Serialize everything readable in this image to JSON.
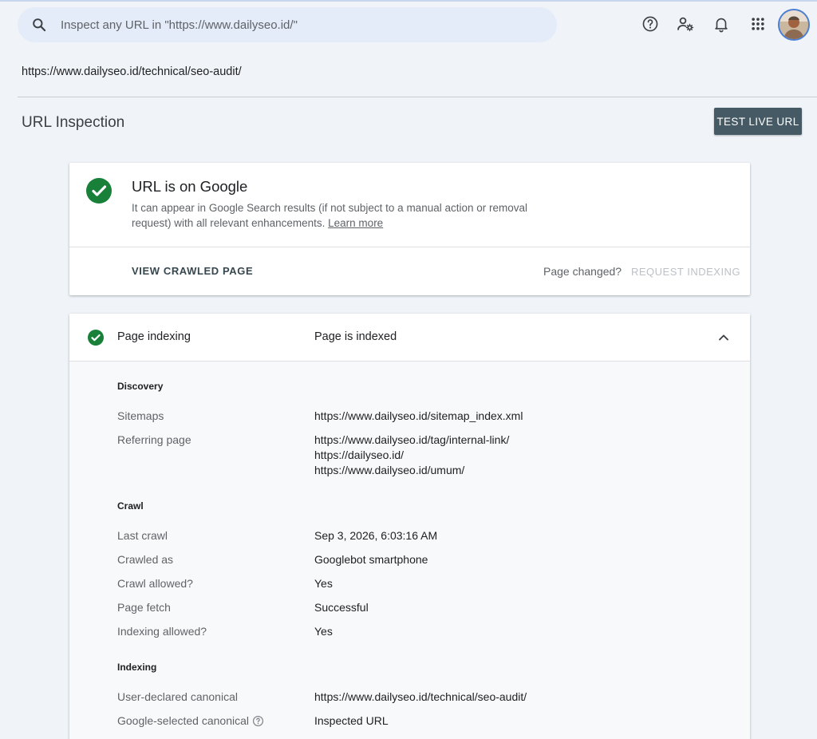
{
  "search": {
    "placeholder": "Inspect any URL in \"https://www.dailyseo.id/\""
  },
  "toolbar_icons": [
    "help-icon",
    "manage-users-icon",
    "notifications-icon",
    "apps-grid-icon"
  ],
  "page_url": "https://www.dailyseo.id/technical/seo-audit/",
  "page_title": "URL Inspection",
  "test_live_url": "TEST LIVE URL",
  "status": {
    "title": "URL is on Google",
    "description": "It can appear in Google Search results (if not subject to a manual action or removal request) with all relevant enhancements.",
    "learn_more": "Learn more",
    "view_crawled": "VIEW CRAWLED PAGE",
    "page_changed": "Page changed?",
    "request_indexing": "REQUEST INDEXING"
  },
  "indexing": {
    "label": "Page indexing",
    "value": "Page is indexed",
    "discovery": {
      "title": "Discovery",
      "sitemaps_label": "Sitemaps",
      "sitemaps_value": "https://www.dailyseo.id/sitemap_index.xml",
      "referring_label": "Referring page",
      "referring_values": [
        "https://www.dailyseo.id/tag/internal-link/",
        "https://dailyseo.id/",
        "https://www.dailyseo.id/umum/"
      ]
    },
    "crawl": {
      "title": "Crawl",
      "rows": [
        {
          "label": "Last crawl",
          "value": "Sep 3, 2026, 6:03:16 AM"
        },
        {
          "label": "Crawled as",
          "value": "Googlebot smartphone"
        },
        {
          "label": "Crawl allowed?",
          "value": "Yes"
        },
        {
          "label": "Page fetch",
          "value": "Successful"
        },
        {
          "label": "Indexing allowed?",
          "value": "Yes"
        }
      ]
    },
    "indexing_section": {
      "title": "Indexing",
      "rows": [
        {
          "label": "User-declared canonical",
          "value": "https://www.dailyseo.id/technical/seo-audit/"
        },
        {
          "label": "Google-selected canonical",
          "value": "Inspected URL"
        }
      ]
    }
  },
  "colors": {
    "accent_dark": "#455a64",
    "success": "#188038",
    "background": "#f0f4f9"
  }
}
